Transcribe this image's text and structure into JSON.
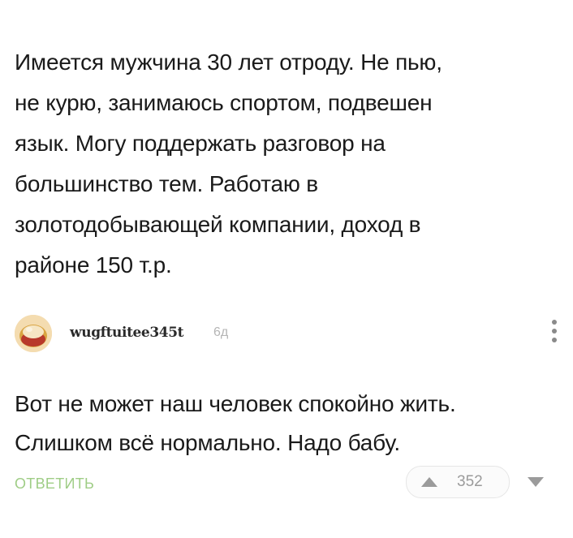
{
  "post": {
    "lines": [
      "Имеется мужчина 30 лет отроду. Не пью,",
      "не курю, занимаюсь спортом, подвешен",
      "язык. Могу поддержать разговор на",
      "большинство тем. Работаю в",
      "золотодобывающей компании, доход в",
      "районе 150 т.р."
    ]
  },
  "comment": {
    "author": "wugftuitee345t",
    "age": "6д",
    "avatar_icon": "avatar-image",
    "more_icon": "more-vertical-icon",
    "lines": [
      "Вот не может наш человек спокойно жить.",
      "Слишком всё нормально. Надо бабу."
    ],
    "reply_label": "ОТВЕТИТЬ",
    "votes": {
      "count": "352",
      "upvote_icon": "upvote-icon",
      "downvote_icon": "downvote-icon"
    }
  },
  "colors": {
    "reply": "#9fcd86",
    "muted": "#9b9b9b",
    "text": "#1a1a1a"
  }
}
